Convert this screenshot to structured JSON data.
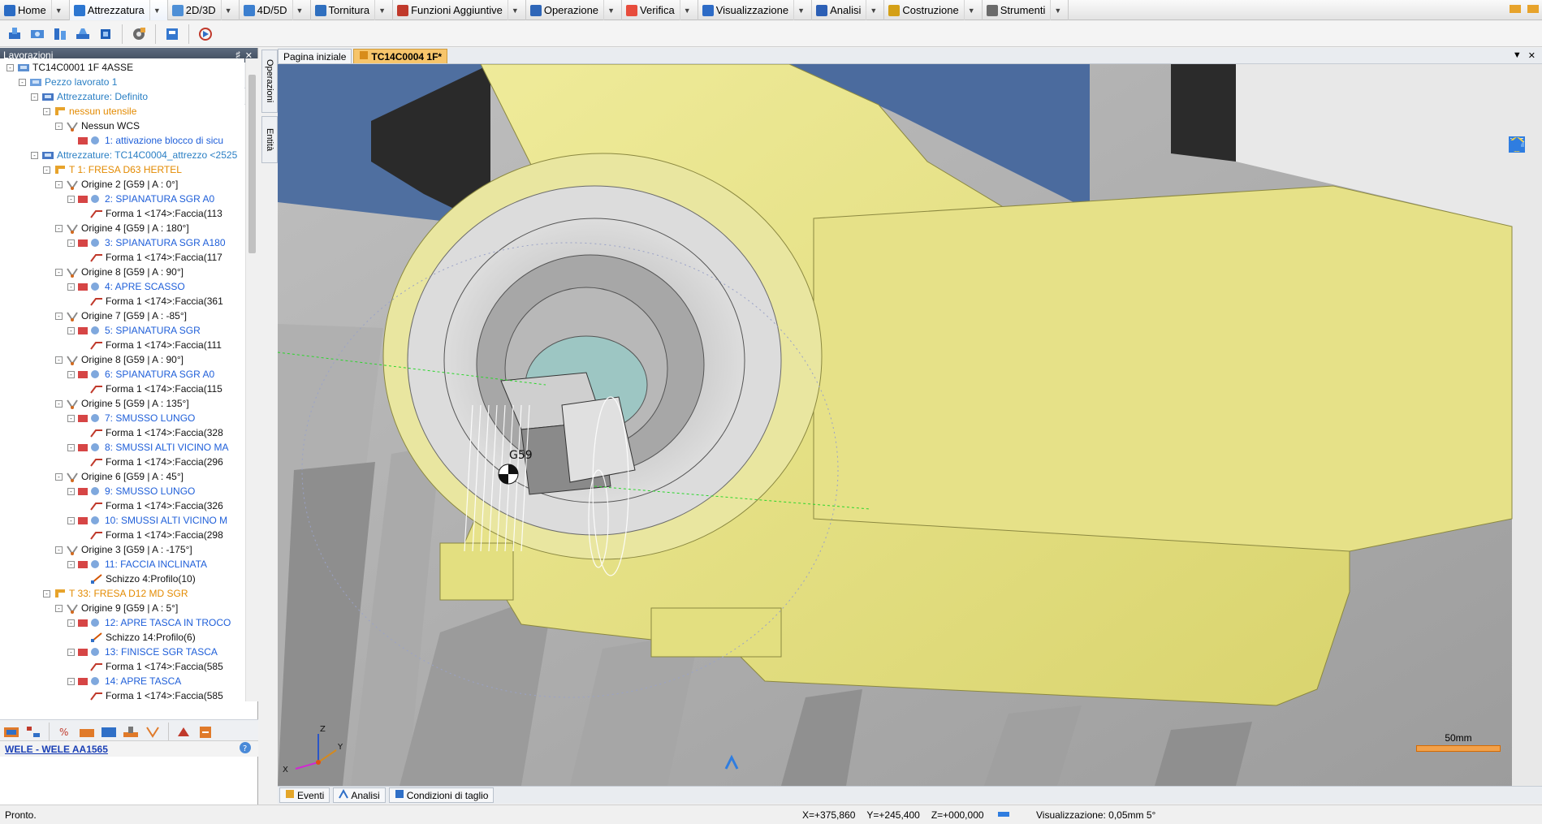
{
  "menu": {
    "tabs": [
      {
        "label": "Home",
        "icon": "home-icon",
        "color": "#2b6cc4"
      },
      {
        "label": "Attrezzatura",
        "icon": "fixture-icon",
        "color": "#2c76d1",
        "active": true
      },
      {
        "label": "2D/3D",
        "icon": "2d3d-icon",
        "color": "#4e8fd6"
      },
      {
        "label": "4D/5D",
        "icon": "4d5d-icon",
        "color": "#3c7fcf"
      },
      {
        "label": "Tornitura",
        "icon": "turning-icon",
        "color": "#2f6fbf"
      },
      {
        "label": "Funzioni Aggiuntive",
        "icon": "functions-icon",
        "color": "#c0392b"
      },
      {
        "label": "Operazione",
        "icon": "operation-icon",
        "color": "#2e66b8"
      },
      {
        "label": "Verifica",
        "icon": "verify-icon",
        "color": "#e74c3c"
      },
      {
        "label": "Visualizzazione",
        "icon": "view-icon",
        "color": "#2d6bc6"
      },
      {
        "label": "Analisi",
        "icon": "analysis-icon",
        "color": "#2c5fb5"
      },
      {
        "label": "Costruzione",
        "icon": "construction-icon",
        "color": "#d4a017"
      },
      {
        "label": "Strumenti",
        "icon": "tools-icon",
        "color": "#6b6b6b"
      }
    ]
  },
  "left_panel": {
    "title": "Lavorazioni",
    "tree": [
      {
        "text": "TC14C0001 1F 4ASSE",
        "level": 0,
        "color": "black",
        "icon": "project-icon",
        "exp": "-"
      },
      {
        "text": "Pezzo lavorato 1",
        "level": 1,
        "color": "teal",
        "icon": "workpiece-icon",
        "exp": "-"
      },
      {
        "text": "Attrezzature: Definito",
        "level": 2,
        "color": "teal",
        "icon": "fixture-icon",
        "exp": "-"
      },
      {
        "text": "nessun utensile",
        "level": 3,
        "color": "orange",
        "icon": "tool-icon",
        "exp": "-"
      },
      {
        "text": "Nessun WCS",
        "level": 4,
        "color": "black",
        "icon": "wcs-icon",
        "exp": "-"
      },
      {
        "text": "1: attivazione blocco di sicu",
        "level": 5,
        "color": "blue",
        "icon": "op-icon",
        "exp": ""
      },
      {
        "text": "Attrezzature: TC14C0004_attrezzo <2525",
        "level": 2,
        "color": "teal",
        "icon": "fixture-icon",
        "exp": "-"
      },
      {
        "text": "T 1: FRESA D63 HERTEL",
        "level": 3,
        "color": "orange",
        "icon": "tool-icon",
        "exp": "-"
      },
      {
        "text": "Origine 2 [G59 | A : 0°]",
        "level": 4,
        "color": "black",
        "icon": "wcs-icon",
        "exp": "-"
      },
      {
        "text": "2: SPIANATURA SGR A0",
        "level": 5,
        "color": "blue",
        "icon": "op-icon",
        "exp": "-"
      },
      {
        "text": "Forma 1 <174>:Faccia(113",
        "level": 6,
        "color": "black",
        "icon": "shape-icon",
        "exp": ""
      },
      {
        "text": "Origine 4 [G59 | A : 180°]",
        "level": 4,
        "color": "black",
        "icon": "wcs-icon",
        "exp": "-"
      },
      {
        "text": "3: SPIANATURA SGR A180",
        "level": 5,
        "color": "blue",
        "icon": "op-icon",
        "exp": "-"
      },
      {
        "text": "Forma 1 <174>:Faccia(117",
        "level": 6,
        "color": "black",
        "icon": "shape-icon",
        "exp": ""
      },
      {
        "text": "Origine 8 [G59 | A : 90°]",
        "level": 4,
        "color": "black",
        "icon": "wcs-icon",
        "exp": "-"
      },
      {
        "text": "4: APRE SCASSO",
        "level": 5,
        "color": "blue",
        "icon": "op-icon",
        "exp": "-"
      },
      {
        "text": "Forma 1 <174>:Faccia(361",
        "level": 6,
        "color": "black",
        "icon": "shape-icon",
        "exp": ""
      },
      {
        "text": "Origine 7 [G59 | A : -85°]",
        "level": 4,
        "color": "black",
        "icon": "wcs-icon",
        "exp": "-"
      },
      {
        "text": "5: SPIANATURA SGR",
        "level": 5,
        "color": "blue",
        "icon": "op-icon",
        "exp": "-"
      },
      {
        "text": "Forma 1 <174>:Faccia(111",
        "level": 6,
        "color": "black",
        "icon": "shape-icon",
        "exp": ""
      },
      {
        "text": "Origine 8 [G59 | A : 90°]",
        "level": 4,
        "color": "black",
        "icon": "wcs-icon",
        "exp": "-"
      },
      {
        "text": "6: SPIANATURA SGR A0",
        "level": 5,
        "color": "blue",
        "icon": "op-icon",
        "exp": "-"
      },
      {
        "text": "Forma 1 <174>:Faccia(115",
        "level": 6,
        "color": "black",
        "icon": "shape-icon",
        "exp": ""
      },
      {
        "text": "Origine 5 [G59 | A : 135°]",
        "level": 4,
        "color": "black",
        "icon": "wcs-icon",
        "exp": "-"
      },
      {
        "text": "7: SMUSSO LUNGO",
        "level": 5,
        "color": "blue",
        "icon": "op-icon",
        "exp": "-"
      },
      {
        "text": "Forma 1 <174>:Faccia(328",
        "level": 6,
        "color": "black",
        "icon": "shape-icon",
        "exp": ""
      },
      {
        "text": "8: SMUSSI ALTI VICINO MA",
        "level": 5,
        "color": "blue",
        "icon": "op-icon",
        "exp": "-"
      },
      {
        "text": "Forma 1 <174>:Faccia(296",
        "level": 6,
        "color": "black",
        "icon": "shape-icon",
        "exp": ""
      },
      {
        "text": "Origine 6 [G59 | A : 45°]",
        "level": 4,
        "color": "black",
        "icon": "wcs-icon",
        "exp": "-"
      },
      {
        "text": "9: SMUSSO LUNGO",
        "level": 5,
        "color": "blue",
        "icon": "op-icon",
        "exp": "-"
      },
      {
        "text": "Forma 1 <174>:Faccia(326",
        "level": 6,
        "color": "black",
        "icon": "shape-icon",
        "exp": ""
      },
      {
        "text": "10: SMUSSI ALTI VICINO M",
        "level": 5,
        "color": "blue",
        "icon": "op-icon",
        "exp": "-"
      },
      {
        "text": "Forma 1 <174>:Faccia(298",
        "level": 6,
        "color": "black",
        "icon": "shape-icon",
        "exp": ""
      },
      {
        "text": "Origine 3 [G59 | A : -175°]",
        "level": 4,
        "color": "black",
        "icon": "wcs-icon",
        "exp": "-"
      },
      {
        "text": "11: FACCIA INCLINATA",
        "level": 5,
        "color": "blue",
        "icon": "op-icon",
        "exp": "-"
      },
      {
        "text": "Schizzo 4:Profilo(10)",
        "level": 6,
        "color": "black",
        "icon": "sketch-icon",
        "exp": ""
      },
      {
        "text": "T 33: FRESA D12 MD SGR",
        "level": 3,
        "color": "orange",
        "icon": "tool-icon",
        "exp": "-"
      },
      {
        "text": "Origine 9 [G59 | A : 5°]",
        "level": 4,
        "color": "black",
        "icon": "wcs-icon",
        "exp": "-"
      },
      {
        "text": "12: APRE TASCA IN TROCO",
        "level": 5,
        "color": "blue",
        "icon": "op-icon",
        "exp": "-"
      },
      {
        "text": "Schizzo 14:Profilo(6)",
        "level": 6,
        "color": "black",
        "icon": "sketch-icon",
        "exp": ""
      },
      {
        "text": "13: FINISCE SGR TASCA",
        "level": 5,
        "color": "blue",
        "icon": "op-icon",
        "exp": "-"
      },
      {
        "text": "Forma 1 <174>:Faccia(585",
        "level": 6,
        "color": "black",
        "icon": "shape-icon",
        "exp": ""
      },
      {
        "text": "14: APRE TASCA",
        "level": 5,
        "color": "blue",
        "icon": "op-icon",
        "exp": "-"
      },
      {
        "text": "Forma 1 <174>:Faccia(585",
        "level": 6,
        "color": "black",
        "icon": "shape-icon",
        "exp": ""
      }
    ],
    "footer_link": "WELE - WELE AA1565"
  },
  "side_tabs": [
    "Operazioni",
    "Entità"
  ],
  "doc_tabs": [
    {
      "label": "Pagina iniziale",
      "active": false
    },
    {
      "label": "TC14C0004 1F*",
      "active": true
    }
  ],
  "viewport": {
    "wcs_label": "G59",
    "scale_label": "50mm",
    "axis_labels": {
      "x": "X",
      "y": "Y",
      "z": "Z"
    }
  },
  "bottom_tabs": [
    "Eventi",
    "Analisi",
    "Condizioni di taglio"
  ],
  "status": {
    "text": "Pronto.",
    "x": "X=+375,860",
    "y": "Y=+245,400",
    "z": "Z=+000,000",
    "zoom": "Visualizzazione: 0,05mm 5°"
  },
  "colors": {
    "part_yellow": "#e9e58a",
    "tab_active": "#f7c56b",
    "panel_title": "#4a5668",
    "link_blue": "#1a3fb5"
  }
}
